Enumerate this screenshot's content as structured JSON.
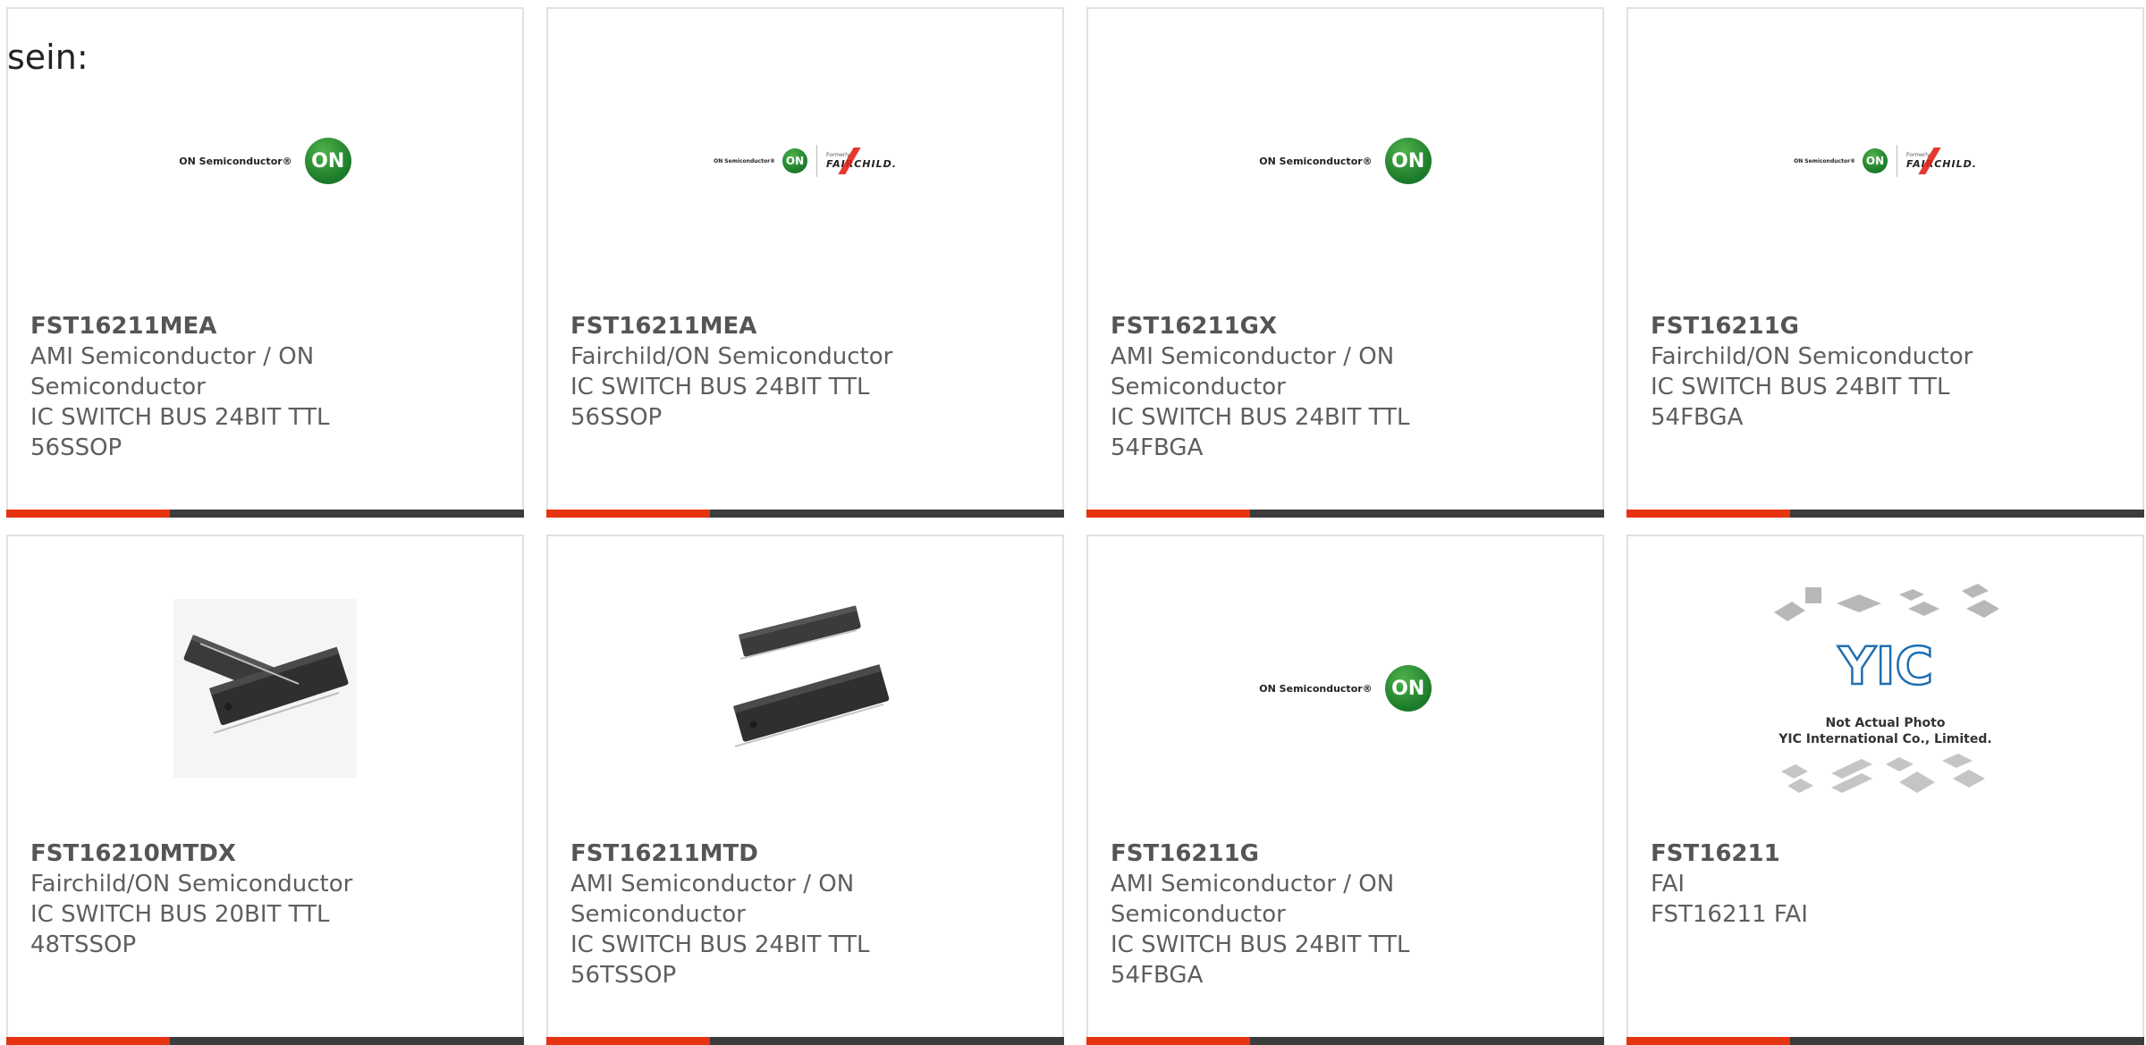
{
  "intro_text": "sein:",
  "colors": {
    "accent": "#e63312",
    "bar_dark": "#3c3c3c",
    "on_green": "#2e9a3a",
    "fairchild_red": "#e2231a"
  },
  "on_logo": {
    "wordmark": "ON Semiconductor®",
    "badge": "ON"
  },
  "fairchild_logo": {
    "formerly": "Formerly",
    "name": "FAIRCHILD."
  },
  "yic_logo": {
    "mark": "YIC",
    "line1": "Not Actual Photo",
    "line2": "YIC International Co., Limited."
  },
  "products": [
    {
      "part_number": "FST16211MEA",
      "manufacturer": "AMI Semiconductor / ON Semiconductor",
      "description": "IC SWITCH BUS 24BIT TTL 56SSOP",
      "image": "on-logo"
    },
    {
      "part_number": "FST16211MEA",
      "manufacturer": "Fairchild/ON Semiconductor",
      "description": "IC SWITCH BUS 24BIT TTL 56SSOP",
      "image": "on-fairchild-logo"
    },
    {
      "part_number": "FST16211GX",
      "manufacturer": "AMI Semiconductor / ON Semiconductor",
      "description": "IC SWITCH BUS 24BIT TTL 54FBGA",
      "image": "on-logo"
    },
    {
      "part_number": "FST16211G",
      "manufacturer": "Fairchild/ON Semiconductor",
      "description": "IC SWITCH BUS 24BIT TTL 54FBGA",
      "image": "on-fairchild-logo"
    },
    {
      "part_number": "FST16210MTDX",
      "manufacturer": "Fairchild/ON Semiconductor",
      "description": "IC SWITCH BUS 20BIT TTL 48TSSOP",
      "image": "chip-photo"
    },
    {
      "part_number": "FST16211MTD",
      "manufacturer": "AMI Semiconductor / ON Semiconductor",
      "description": "IC SWITCH BUS 24BIT TTL 56TSSOP",
      "image": "chip-photo"
    },
    {
      "part_number": "FST16211G",
      "manufacturer": "AMI Semiconductor / ON Semiconductor",
      "description": "IC SWITCH BUS 24BIT TTL 54FBGA",
      "image": "on-logo"
    },
    {
      "part_number": "FST16211",
      "manufacturer": "FAI",
      "description": "FST16211 FAI",
      "image": "yic-placeholder"
    }
  ]
}
